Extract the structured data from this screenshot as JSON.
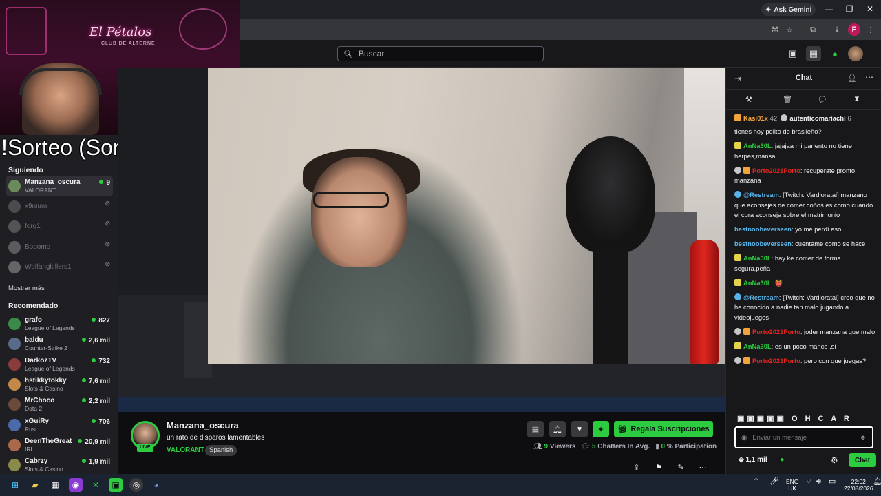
{
  "browser": {
    "ask_gemini": "Ask Gemini",
    "profile_initial": "F"
  },
  "overlay": {
    "logo": "El Pétalos",
    "club": "CLUB DE ALTERNE",
    "sorteo": "!Sorteo (Sorteo Activo)!"
  },
  "search": {
    "placeholder": "Buscar"
  },
  "sidebar": {
    "following_header": "Siguiendo",
    "following": [
      {
        "name": "Manzana_oscura",
        "game": "VALORANT",
        "viewers": "9",
        "live": true,
        "color": "#6a8a5a"
      },
      {
        "name": "x9nium",
        "game": "",
        "viewers": "",
        "live": false,
        "color": "#777"
      },
      {
        "name": "forg1",
        "game": "",
        "viewers": "",
        "live": false,
        "color": "#888"
      },
      {
        "name": "Bopomo",
        "game": "",
        "viewers": "",
        "live": false,
        "color": "#999"
      },
      {
        "name": "Wolfangkillers1",
        "game": "",
        "viewers": "",
        "live": false,
        "color": "#aaa"
      }
    ],
    "show_more": "Mostrar más",
    "recommended_header": "Recomendado",
    "recommended": [
      {
        "name": "grafo",
        "game": "League of Legends",
        "viewers": "827",
        "color": "#3b8a4a"
      },
      {
        "name": "baldu",
        "game": "Counter-Strike 2",
        "viewers": "2,6 mil",
        "color": "#5a6a8a"
      },
      {
        "name": "DarkozTV",
        "game": "League of Legends",
        "viewers": "732",
        "color": "#8a3b3b"
      },
      {
        "name": "hstikkytokky",
        "game": "Slots & Casino",
        "viewers": "7,6 mil",
        "color": "#c28a4a"
      },
      {
        "name": "MrChoco",
        "game": "Dota 2",
        "viewers": "2,2 mil",
        "color": "#6a4a3a"
      },
      {
        "name": "xGuiRy",
        "game": "Rust",
        "viewers": "706",
        "color": "#4a6aaa"
      },
      {
        "name": "DeenTheGreat",
        "game": "IRL",
        "viewers": "20,9 mil",
        "color": "#aa6a4a"
      },
      {
        "name": "Cabrzy",
        "game": "Slots & Casino",
        "viewers": "1,9 mil",
        "color": "#8a8a4a"
      }
    ]
  },
  "channel": {
    "name": "Manzana_oscura",
    "title": "un rato de disparos lamentables",
    "game": "VALORANT",
    "tag": "Spanish",
    "live": "LIVE",
    "subscribe_label": "Regala Suscripciones",
    "viewers_count": "9",
    "viewers_label": "Viewers",
    "chatters_count": "5",
    "chatters_label": "Chatters In Avg.",
    "participation_count": "0",
    "participation_label": "% Participation"
  },
  "chat": {
    "title": "Chat",
    "pinned_user1": "Kasi01x",
    "pinned_count1": "42",
    "pinned_user2": "autenticomariachi",
    "pinned_count2": "6",
    "messages": [
      {
        "badges": [],
        "user": "",
        "color": "",
        "text": "tienes hoy pelito de brasileño?"
      },
      {
        "badges": [
          "sub"
        ],
        "user": "AnNa30L",
        "color": "#2ccb40",
        "text": "jajajaa mi parlento no tiene herpes,mansa"
      },
      {
        "badges": [
          "mod",
          "crown"
        ],
        "user": "Porto2021Porto",
        "color": "#e0261f",
        "text": "recuperate pronto manzana"
      },
      {
        "badges": [
          "bot"
        ],
        "user": "@Restream",
        "color": "#56b4e9",
        "text": "[Twitch: Vardioratai] manzano que aconsejes de comer coños es como cuando el cura aconseja sobre el matrimonio"
      },
      {
        "badges": [],
        "user": "bestnoobeverseen",
        "color": "#56b4e9",
        "text": "yo me perdí eso"
      },
      {
        "badges": [],
        "user": "bestnoobeverseen",
        "color": "#56b4e9",
        "text": "cuentame como se hace"
      },
      {
        "badges": [
          "sub"
        ],
        "user": "AnNa30L",
        "color": "#2ccb40",
        "text": "hay ke comer de forma segura,peña"
      },
      {
        "badges": [
          "sub"
        ],
        "user": "AnNa30L",
        "color": "#2ccb40",
        "text": "👹"
      },
      {
        "badges": [
          "bot"
        ],
        "user": "@Restream",
        "color": "#56b4e9",
        "text": "[Twitch: Vardioratai] creo que no he conocido a nadie tan malo jugando a videojuegos"
      },
      {
        "badges": [
          "mod",
          "crown"
        ],
        "user": "Porto2021Porto",
        "color": "#e0261f",
        "text": "joder manzana que malo"
      },
      {
        "badges": [
          "sub"
        ],
        "user": "AnNa30L",
        "color": "#2ccb40",
        "text": "es un poco manco ,si"
      },
      {
        "badges": [
          "mod",
          "crown"
        ],
        "user": "Porto2021Porto",
        "color": "#e0261f",
        "text": "pero con que juegas?"
      }
    ],
    "emote_letters": "O H C A R",
    "input_placeholder": "Enviar un mensaje",
    "points": "1,1 mil",
    "send_label": "Chat"
  },
  "taskbar": {
    "lang": "ENG",
    "region": "UK",
    "time": "22:02",
    "date": "22/08/2026"
  }
}
